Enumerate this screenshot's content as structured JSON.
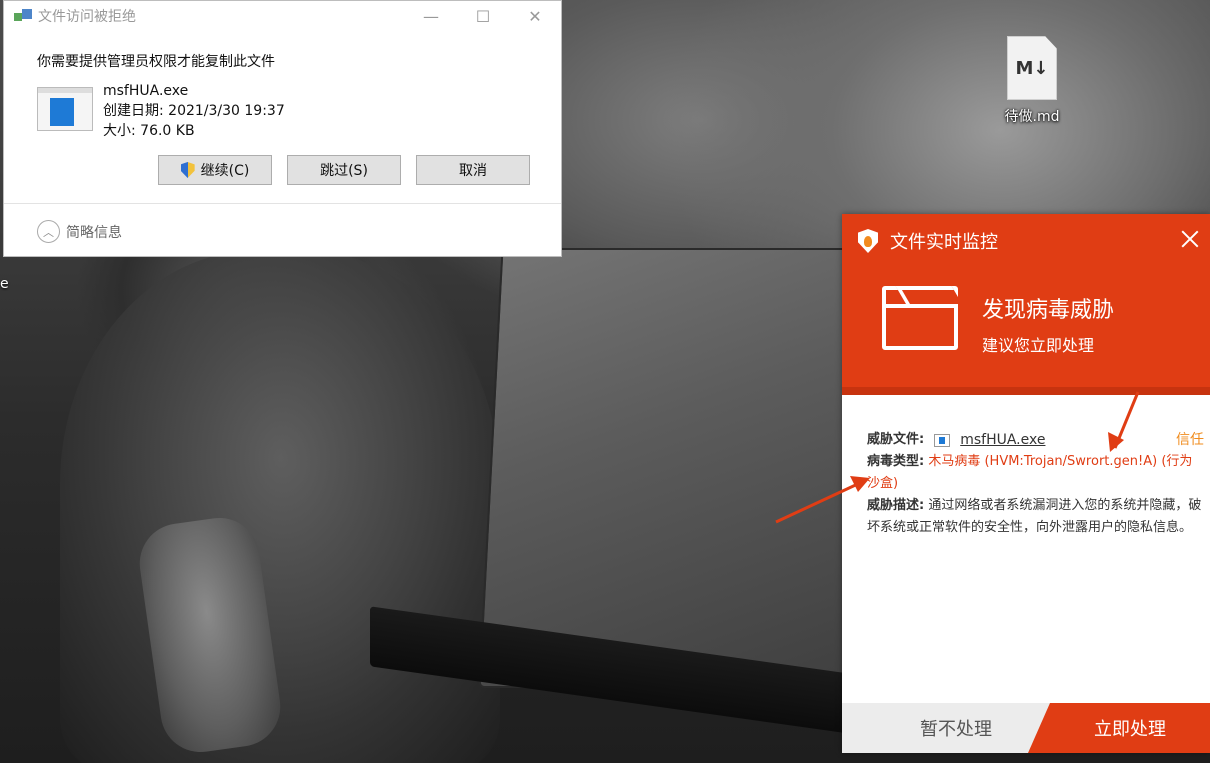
{
  "desktop": {
    "partial_label": "e",
    "icons": [
      {
        "name": "待做.md",
        "glyph": "M↓"
      }
    ]
  },
  "dialog": {
    "title": "文件访问被拒绝",
    "heading": "你需要提供管理员权限才能复制此文件",
    "file": {
      "name": "msfHUA.exe",
      "created": "创建日期: 2021/3/30 19:37",
      "size": "大小: 76.0 KB"
    },
    "buttons": {
      "continue": "继续(C)",
      "skip": "跳过(S)",
      "cancel": "取消"
    },
    "details_toggle": "简略信息",
    "controls": {
      "minimize": "—",
      "maximize": "☐",
      "close": "✕"
    }
  },
  "antivirus": {
    "title": "文件实时监控",
    "alert_title": "发现病毒威胁",
    "alert_subtitle": "建议您立即处理",
    "threat_file_label": "威胁文件:",
    "threat_file_name": "msfHUA.exe",
    "trust_label": "信任",
    "virus_type_label": "病毒类型:",
    "virus_type_value": "木马病毒 (HVM:Trojan/Swrort.gen!A)",
    "virus_type_extra": "(行为沙盒)",
    "threat_desc_label": "威胁描述:",
    "threat_desc_value": "通过网络或者系统漏洞进入您的系统并隐藏，破坏系统或正常软件的安全性，向外泄露用户的隐私信息。",
    "buttons": {
      "ignore": "暂不处理",
      "handle": "立即处理"
    },
    "colors": {
      "accent": "#e03d14",
      "trust": "#f08c1e"
    }
  }
}
